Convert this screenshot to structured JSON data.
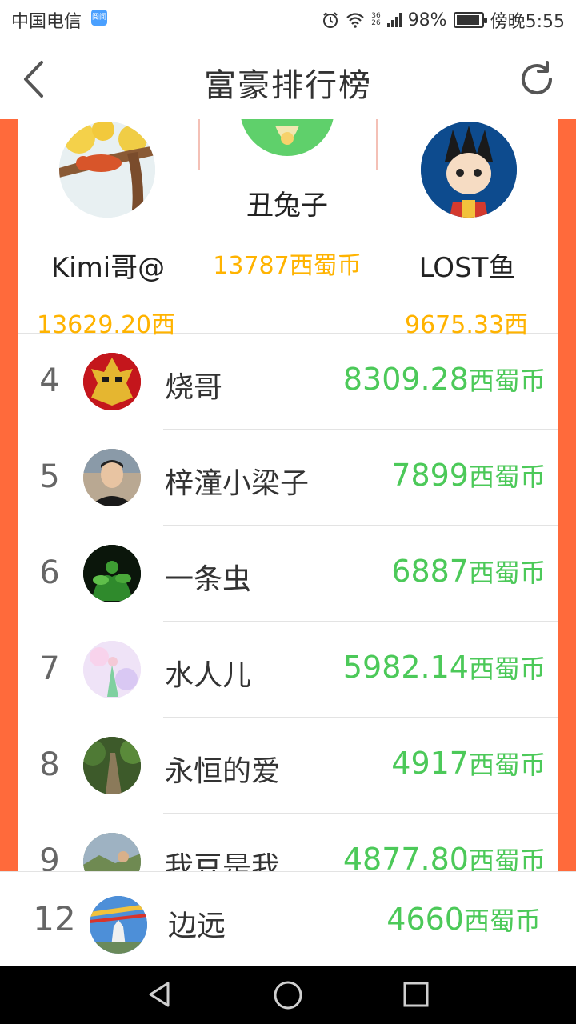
{
  "status_bar": {
    "carrier": "中国电信",
    "app_badge": "阅闻",
    "battery": "98%",
    "time": "傍晚5:55",
    "network_top": "36",
    "network_bottom": "26"
  },
  "header": {
    "title": "富豪排行榜",
    "back_icon": "chevron-left-icon",
    "refresh_icon": "refresh-icon"
  },
  "podium": {
    "first": {
      "name": "丑兔子",
      "amount": "13787西蜀币"
    },
    "second": {
      "name": "Kimi哥@",
      "amount": "13629.20西"
    },
    "third": {
      "name": "LOST鱼",
      "amount": "9675.33西"
    }
  },
  "rankings": [
    {
      "rank": "4",
      "name": "烧哥",
      "amount": "8309.28",
      "unit": "西蜀币"
    },
    {
      "rank": "5",
      "name": "梓潼小梁子",
      "amount": "7899",
      "unit": "西蜀币"
    },
    {
      "rank": "6",
      "name": "一条虫",
      "amount": "6887",
      "unit": "西蜀币"
    },
    {
      "rank": "7",
      "name": "水人儿",
      "amount": "5982.14",
      "unit": "西蜀币"
    },
    {
      "rank": "8",
      "name": "永恒的爱",
      "amount": "4917",
      "unit": "西蜀币"
    },
    {
      "rank": "9",
      "name": "我豆是我",
      "amount": "4877.80",
      "unit": "西蜀币"
    }
  ],
  "my_rank": {
    "rank": "12",
    "name": "边远",
    "amount": "4660",
    "unit": "西蜀币"
  },
  "colors": {
    "accent": "#ff6a3b",
    "gold": "#ffb300",
    "green": "#4cc959"
  }
}
